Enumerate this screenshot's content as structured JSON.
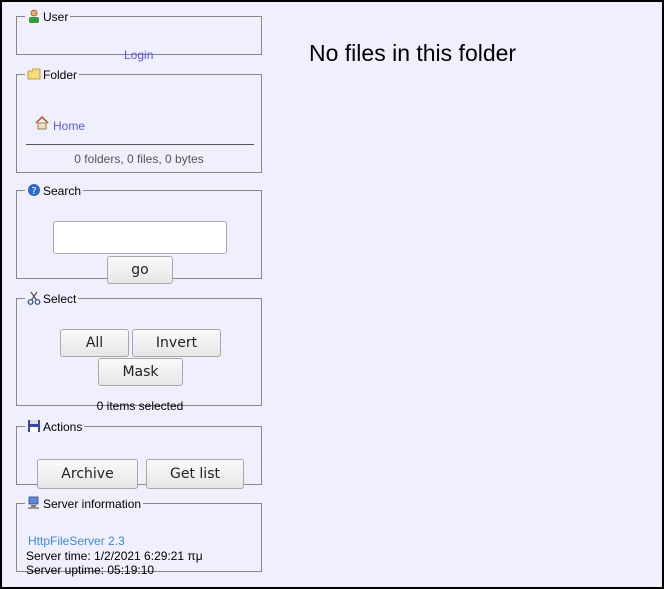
{
  "user": {
    "legend": "User",
    "login_label": "Login"
  },
  "folder": {
    "legend": "Folder",
    "home_label": "Home",
    "summary": "0 folders, 0 files, 0 bytes"
  },
  "search": {
    "legend": "Search",
    "input_value": "",
    "go_label": "go"
  },
  "select": {
    "legend": "Select",
    "all_label": "All",
    "invert_label": "Invert",
    "mask_label": "Mask",
    "status": "0 items selected"
  },
  "actions": {
    "legend": "Actions",
    "archive_label": "Archive",
    "getlist_label": "Get list"
  },
  "server": {
    "legend": "Server information",
    "name": "HttpFileServer 2.3",
    "time": "Server time: 1/2/2021 6:29:21 πμ",
    "uptime": "Server uptime: 05:19:10"
  },
  "main": {
    "message": "No files in this folder"
  },
  "colors": {
    "background": "#efeffe",
    "link": "#5a5ad8",
    "server_link": "#3d8ad8"
  }
}
